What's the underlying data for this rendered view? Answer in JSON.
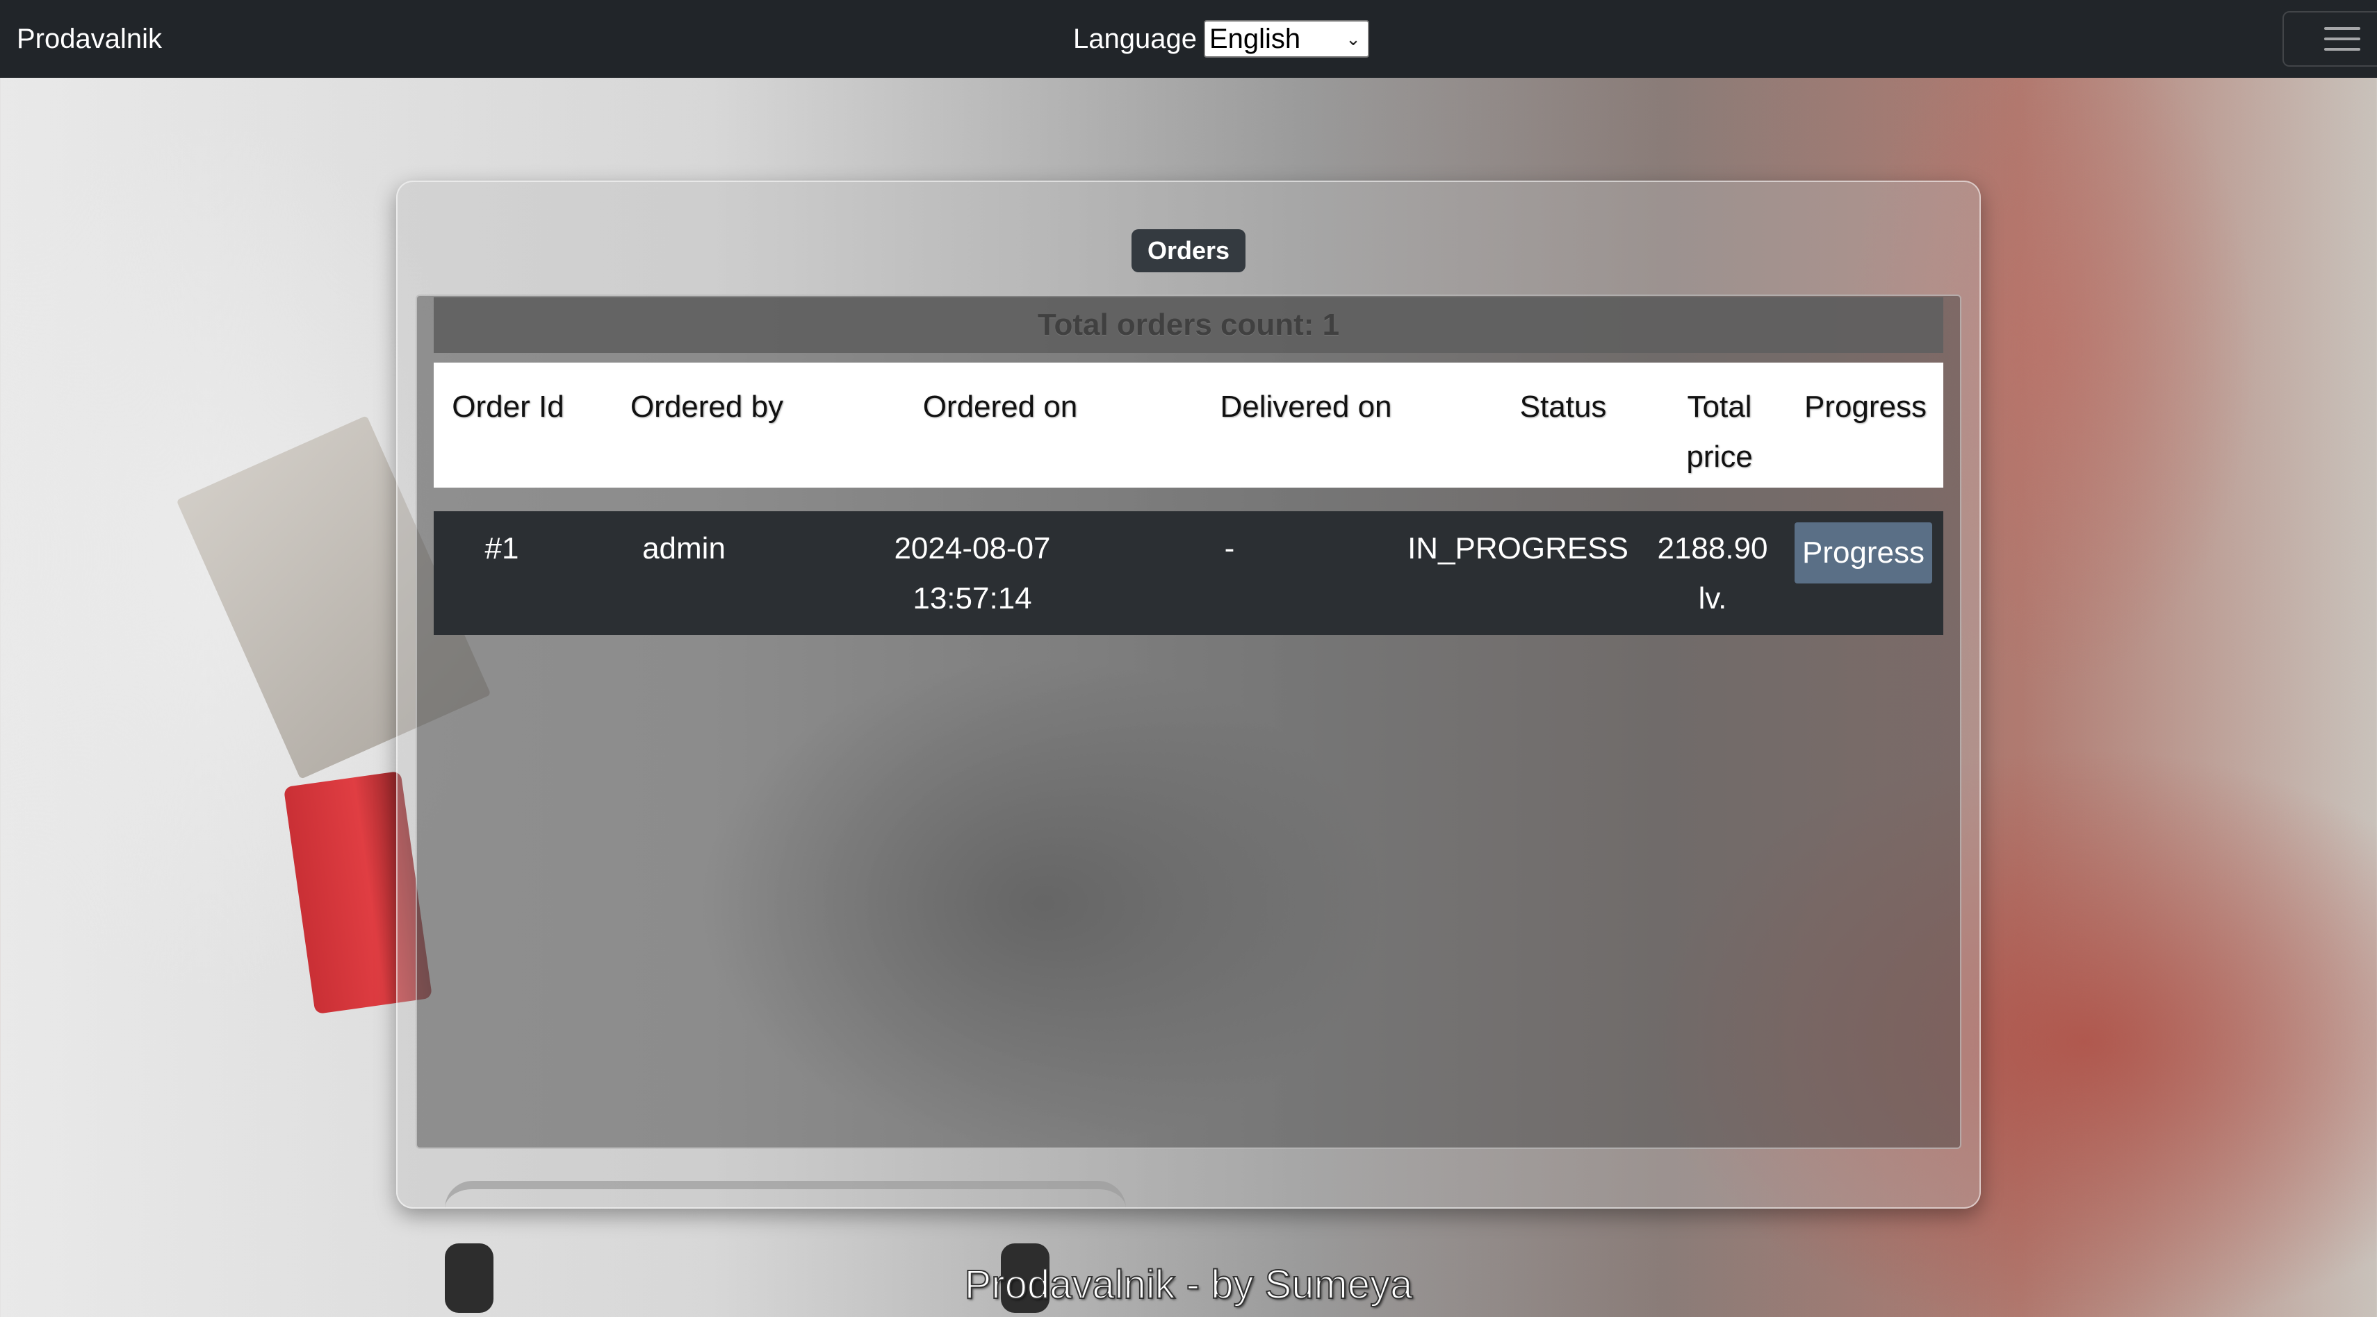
{
  "navbar": {
    "brand": "Prodavalnik",
    "language_label": "Language",
    "language_selected": "English"
  },
  "orders": {
    "badge": "Orders",
    "caption": "Total orders count: 1",
    "columns": {
      "order_id": "Order Id",
      "ordered_by": "Ordered by",
      "ordered_on": "Ordered on",
      "delivered_on": "Delivered on",
      "status": "Status",
      "total_price_1": "Total",
      "total_price_2": "price",
      "progress": "Progress"
    },
    "rows": [
      {
        "order_id": "#1",
        "ordered_by": "admin",
        "ordered_on_date": "2024-08-07",
        "ordered_on_time": "13:57:14",
        "delivered_on": "-",
        "status": "IN_PROGRESS",
        "total_price_amount": "2188.90",
        "total_price_currency": "lv.",
        "progress_button": "Progress"
      }
    ]
  },
  "footer": {
    "text": "Prodavalnik - by Sumeya"
  }
}
